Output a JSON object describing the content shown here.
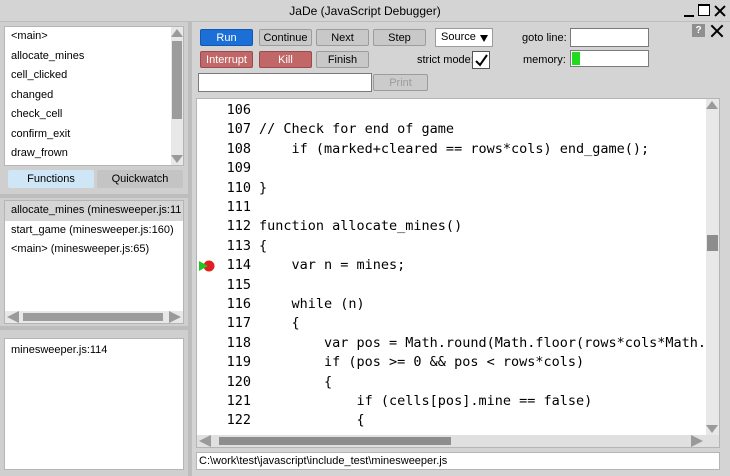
{
  "window": {
    "title": "JaDe (JavaScript Debugger)"
  },
  "functions_list": {
    "items": [
      "<main>",
      "allocate_mines",
      "cell_clicked",
      "changed",
      "check_cell",
      "confirm_exit",
      "draw_frown"
    ]
  },
  "tabs": {
    "functions": "Functions",
    "quickwatch": "Quickwatch"
  },
  "call_stack": {
    "items": [
      "allocate_mines (minesweeper.js:11",
      "start_game (minesweeper.js:160)",
      "<main> (minesweeper.js:65)"
    ]
  },
  "breakpoints": {
    "items": [
      "minesweeper.js:114"
    ]
  },
  "toolbar": {
    "run": "Run",
    "continue": "Continue",
    "next": "Next",
    "step": "Step",
    "source": "Source",
    "interrupt": "Interrupt",
    "kill": "Kill",
    "finish": "Finish",
    "print": "Print",
    "goto_line_label": "goto line:",
    "strict_mode_label": "strict mode:",
    "memory_label": "memory:",
    "help": "?",
    "goto_line_value": "",
    "print_input_value": ""
  },
  "status": {
    "strict_mode_checked": true,
    "memory_fraction": 0.11
  },
  "editor": {
    "current_line": 114,
    "lines": [
      {
        "n": "106",
        "text": ""
      },
      {
        "n": "107",
        "text": "// Check for end of game"
      },
      {
        "n": "108",
        "text": "    if (marked+cleared == rows*cols) end_game();"
      },
      {
        "n": "109",
        "text": ""
      },
      {
        "n": "110",
        "text": "}"
      },
      {
        "n": "111",
        "text": ""
      },
      {
        "n": "112",
        "text": "function allocate_mines()"
      },
      {
        "n": "113",
        "text": "{"
      },
      {
        "n": "114",
        "text": "    var n = mines;"
      },
      {
        "n": "115",
        "text": ""
      },
      {
        "n": "116",
        "text": "    while (n)"
      },
      {
        "n": "117",
        "text": "    {"
      },
      {
        "n": "118",
        "text": "        var pos = Math.round(Math.floor(rows*cols*Math."
      },
      {
        "n": "119",
        "text": "        if (pos >= 0 && pos < rows*cols)"
      },
      {
        "n": "120",
        "text": "        {"
      },
      {
        "n": "121",
        "text": "            if (cells[pos].mine == false)"
      },
      {
        "n": "122",
        "text": "            {"
      }
    ]
  },
  "file_path": "C:\\work\\test\\javascript\\include_test\\minesweeper.js",
  "colors": {
    "run": "#1c6fd6",
    "interrupt": "#c16767",
    "kill": "#c16767",
    "memory": "#1fdc1f",
    "breakpoint": "#e02020",
    "current_arrow": "#22c322"
  }
}
